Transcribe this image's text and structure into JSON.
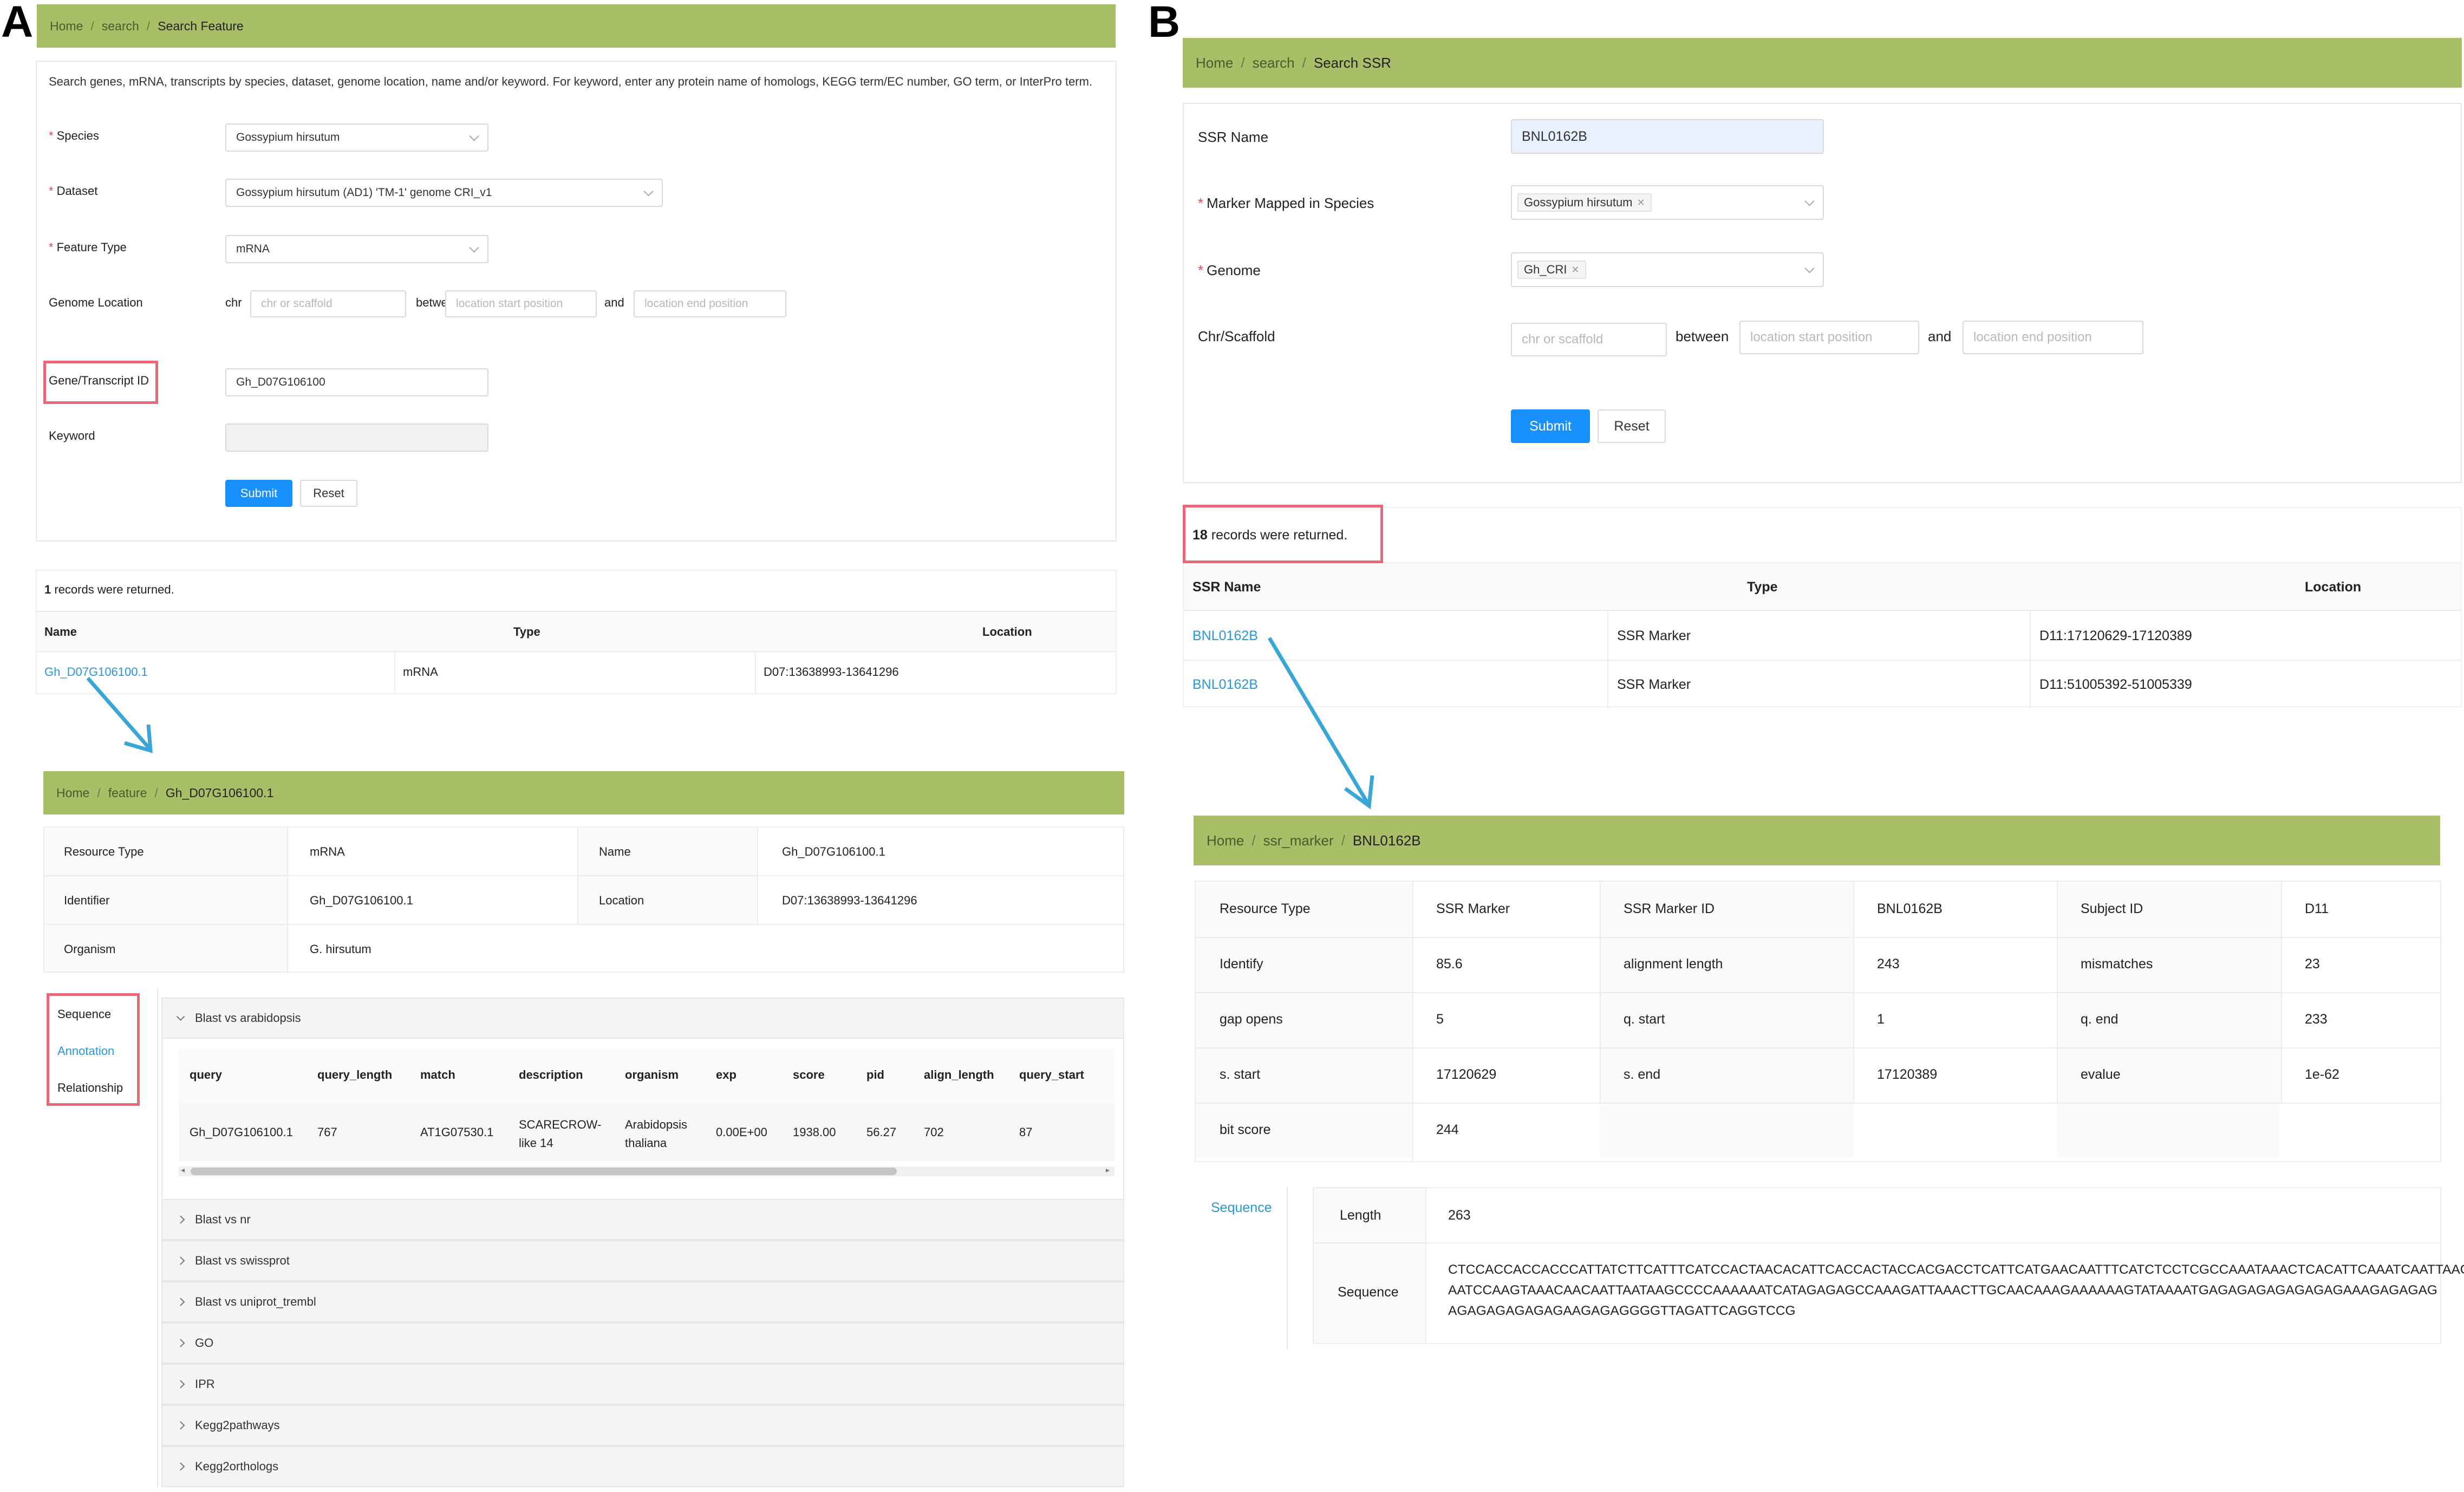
{
  "panel_a": {
    "letter": "A",
    "search_breadcrumb": [
      "Home",
      "search",
      "Search Feature"
    ],
    "description": "Search genes, mRNA, transcripts by species, dataset, genome location, name and/or keyword. For keyword, enter any protein name of homologs, KEGG term/EC number, GO term, or InterPro term.",
    "form": {
      "species_label": "Species",
      "species_value": "Gossypium hirsutum",
      "dataset_label": "Dataset",
      "dataset_value": "Gossypium hirsutum (AD1) 'TM-1' genome CRI_v1",
      "feature_type_label": "Feature Type",
      "feature_type_value": "mRNA",
      "genome_location_label": "Genome Location",
      "chr_label": "chr",
      "chr_placeholder": "chr or scaffold",
      "between_label": "between",
      "start_placeholder": "location start position",
      "and_label": "and",
      "end_placeholder": "location end position",
      "gene_id_label": "Gene/Transcript ID",
      "gene_id_value": "Gh_D07G106100",
      "keyword_label": "Keyword",
      "keyword_value": "",
      "submit_label": "Submit",
      "reset_label": "Reset"
    },
    "results": {
      "count": "1",
      "suffix": "records were returned.",
      "headers": [
        "Name",
        "Type",
        "Location"
      ],
      "rows": [
        {
          "name": "Gh_D07G106100.1",
          "type": "mRNA",
          "location": "D07:13638993-13641296"
        }
      ]
    },
    "feature_breadcrumb": [
      "Home",
      "feature",
      "Gh_D07G106100.1"
    ],
    "feature_info": {
      "resource_type_label": "Resource Type",
      "resource_type_value": "mRNA",
      "name_label": "Name",
      "name_value": "Gh_D07G106100.1",
      "identifier_label": "Identifier",
      "identifier_value": "Gh_D07G106100.1",
      "location_label": "Location",
      "location_value": "D07:13638993-13641296",
      "organism_label": "Organism",
      "organism_value": "G. hirsutum"
    },
    "side_tabs": [
      "Sequence",
      "Annotation",
      "Relationship"
    ],
    "blast_section": {
      "title": "Blast vs arabidopsis",
      "headers": [
        "query",
        "query_length",
        "match",
        "description",
        "organism",
        "exp",
        "score",
        "pid",
        "align_length",
        "query_start"
      ],
      "row": {
        "query": "Gh_D07G106100.1",
        "query_length": "767",
        "match": "AT1G07530.1",
        "description_1": "SCARECROW-",
        "description_2": "like 14",
        "organism_1": "Arabidopsis",
        "organism_2": "thaliana",
        "exp": "0.00E+00",
        "score": "1938.00",
        "pid": "56.27",
        "align_length": "702",
        "query_start": "87"
      }
    },
    "collapsed_sections": [
      "Blast vs nr",
      "Blast vs swissprot",
      "Blast vs uniprot_trembl",
      "GO",
      "IPR",
      "Kegg2pathways",
      "Kegg2orthologs"
    ]
  },
  "panel_b": {
    "letter": "B",
    "search_breadcrumb": [
      "Home",
      "search",
      "Search SSR"
    ],
    "form": {
      "ssr_name_label": "SSR Name",
      "ssr_name_value": "BNL0162B",
      "species_label": "Marker Mapped in Species",
      "species_tag": "Gossypium hirsutum",
      "genome_label": "Genome",
      "genome_tag": "Gh_CRI",
      "chr_label": "Chr/Scaffold",
      "chr_placeholder": "chr or scaffold",
      "between_label": "between",
      "start_placeholder": "location start position",
      "and_label": "and",
      "end_placeholder": "location end position",
      "submit_label": "Submit",
      "reset_label": "Reset"
    },
    "results": {
      "count": "18",
      "suffix": "records were returned.",
      "headers": [
        "SSR Name",
        "Type",
        "Location"
      ],
      "rows": [
        {
          "name": "BNL0162B",
          "type": "SSR Marker",
          "location": "D11:17120629-17120389"
        },
        {
          "name": "BNL0162B",
          "type": "SSR Marker",
          "location": "D11:51005392-51005339"
        }
      ]
    },
    "marker_breadcrumb": [
      "Home",
      "ssr_marker",
      "BNL0162B"
    ],
    "marker_info": [
      [
        "Resource Type",
        "SSR Marker",
        "SSR Marker ID",
        "BNL0162B",
        "Subject ID",
        "D11"
      ],
      [
        "Identify",
        "85.6",
        "alignment length",
        "243",
        "mismatches",
        "23"
      ],
      [
        "gap opens",
        "5",
        "q. start",
        "1",
        "q. end",
        "233"
      ],
      [
        "s. start",
        "17120629",
        "s. end",
        "17120389",
        "evalue",
        "1e-62"
      ],
      [
        "bit score",
        "244",
        "",
        "",
        "",
        ""
      ]
    ],
    "sequence_tab": "Sequence",
    "length_label": "Length",
    "length_value": "263",
    "sequence_label": "Sequence",
    "sequence_lines": [
      "CTCCACCACCACCCATTATCTTCATTTCATCCACTAACACATTCACCACTACCACGACCTCATTCATGAACAATTTCATCTCCTCGCCAAATAAACTCACATTCAAATCAATTAAG",
      "AATCCAAGTAAACAACAATTAATAAGCCCCAAAAAATCATAGAGAGCCAAAGATTAAACTTGCAACAAAGAAAAAAGTATAAAATGAGAGAGAGAGAGAGAAAGAGAGAG",
      "AGAGAGAGAGAGAAGAGAGGGGTTAGATTCAGGTCCG"
    ]
  },
  "colors": {
    "breadcrumb_bg": "#a8bf68",
    "link": "#2a98d8",
    "primary_button": "#1890ff",
    "highlight_box": "#e8687a",
    "arrow": "#3aa6d8"
  }
}
